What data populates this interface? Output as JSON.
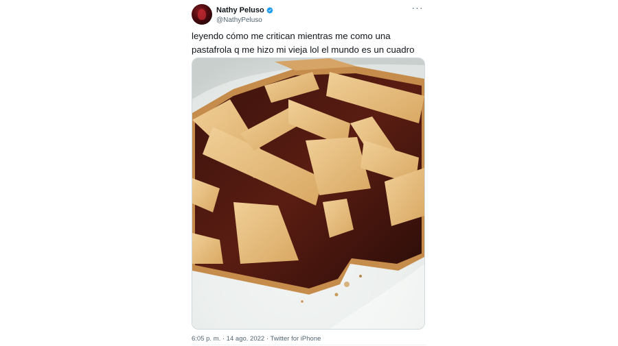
{
  "tweet": {
    "author": {
      "display_name": "Nathy Peluso",
      "handle": "@NathyPeluso",
      "verified": true,
      "verified_color": "#1d9bf0"
    },
    "more_icon": "more-options-icon",
    "text_lines": [
      "leyendo cómo me critican mientras me como una",
      "pastafrola q me hizo mi vieja lol el mundo es un cuadro"
    ],
    "media": {
      "alt": "pastafrola"
    },
    "meta": {
      "time": "6:05 p. m.",
      "separator": "·",
      "date": "14 ago. 2022",
      "source": "Twitter for iPhone"
    }
  }
}
